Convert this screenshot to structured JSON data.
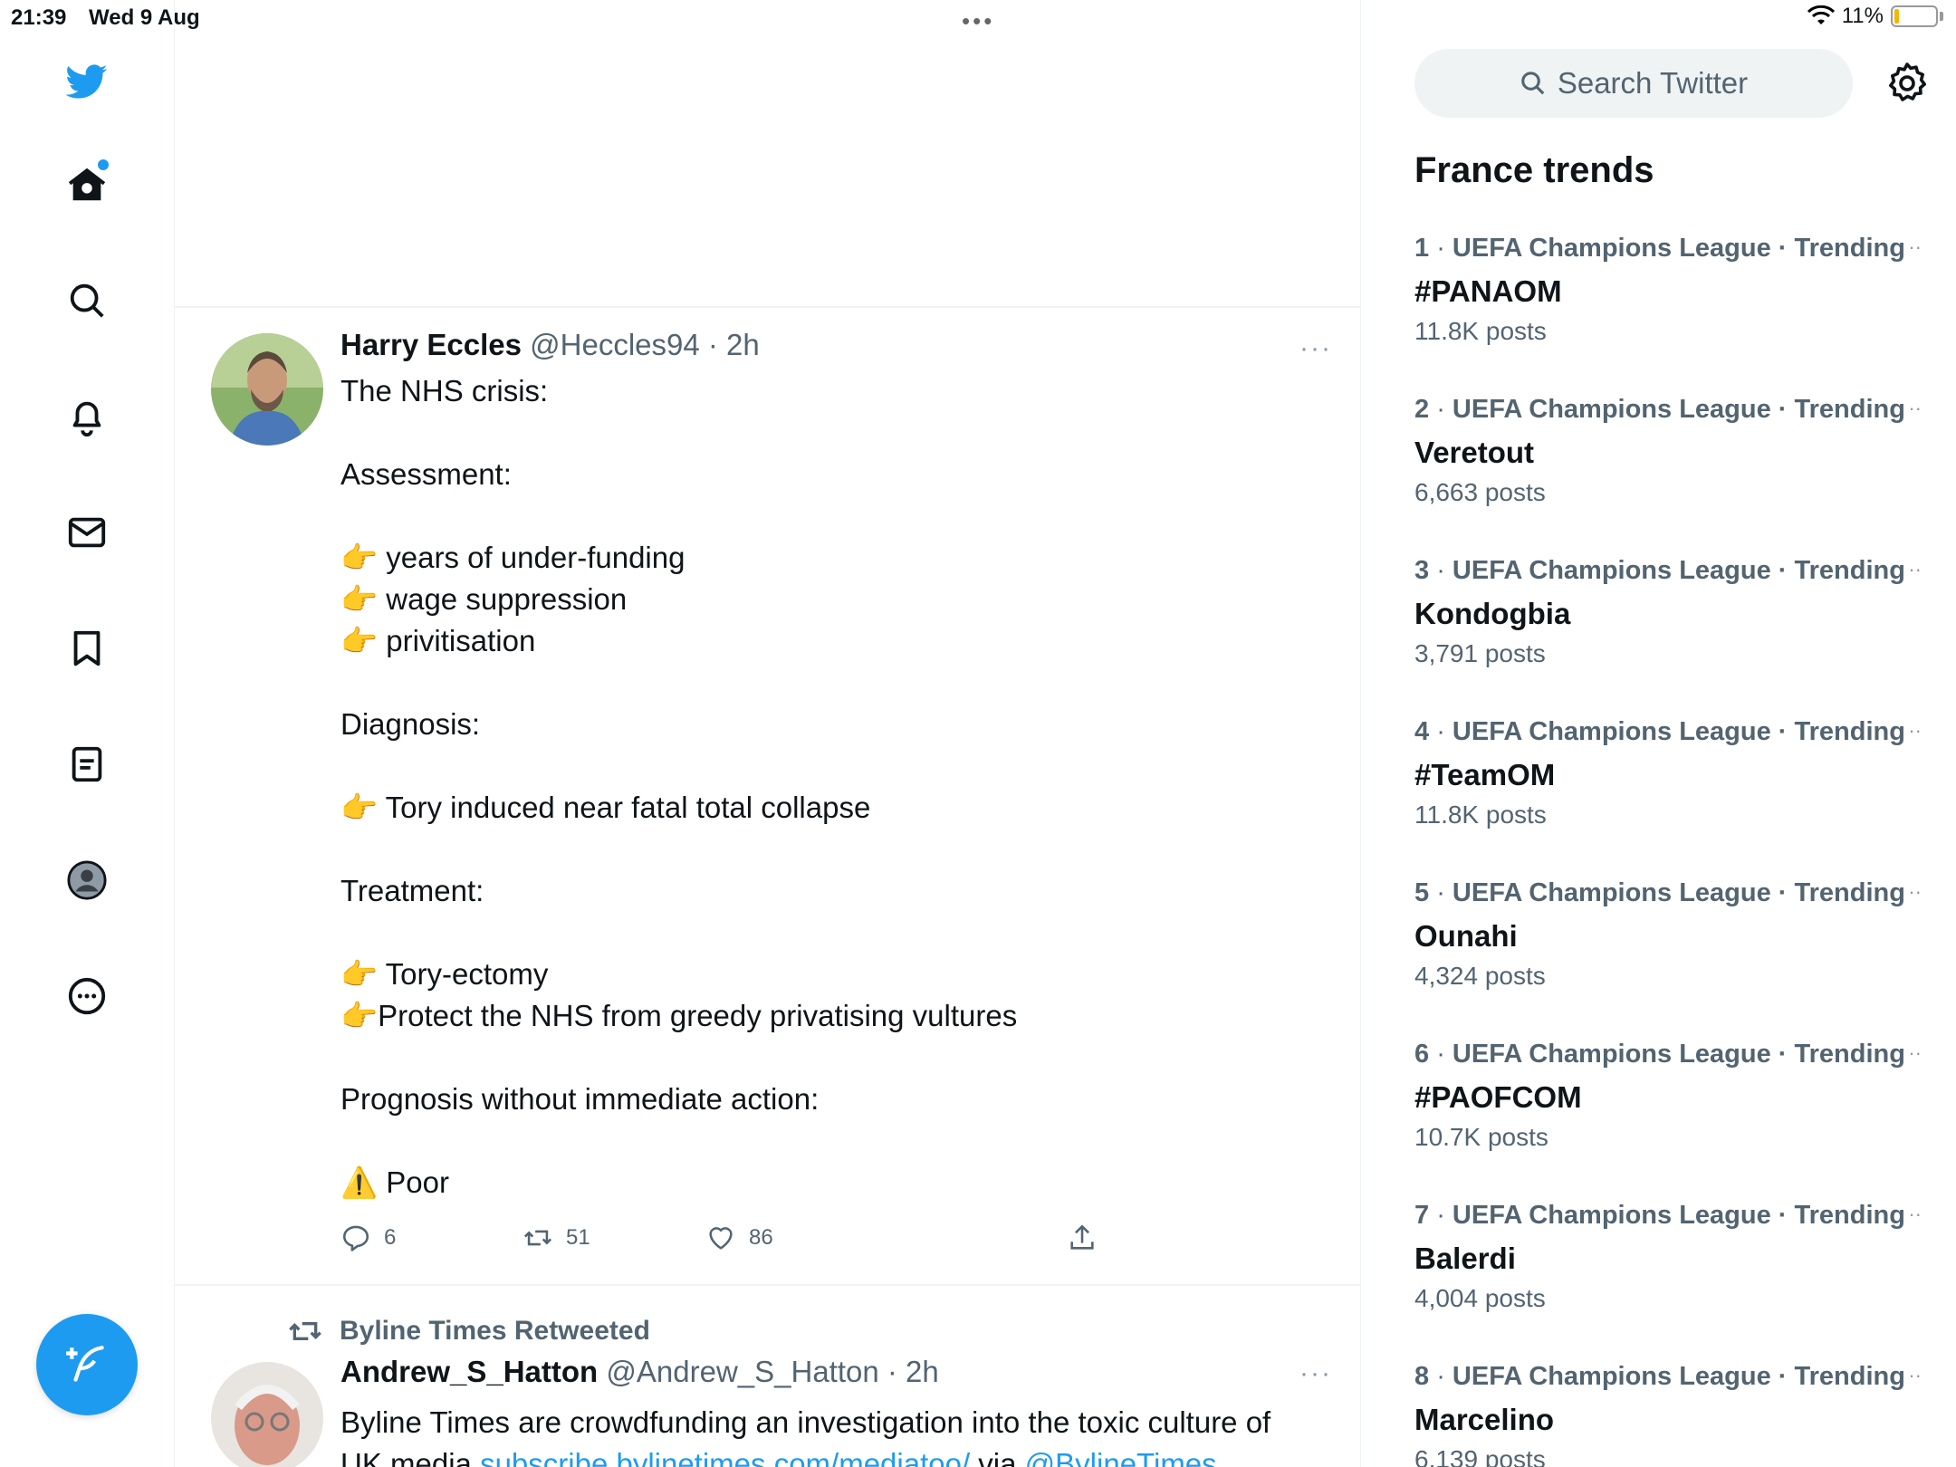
{
  "status_bar": {
    "time": "21:39",
    "date": "Wed 9 Aug",
    "battery": "11%",
    "battery_level": 0.11
  },
  "nav": {
    "icons": [
      "twitter-logo-icon",
      "home-icon",
      "search-icon",
      "bell-icon",
      "mail-icon",
      "bookmark-icon",
      "list-icon",
      "profile-icon",
      "more-icon"
    ],
    "compose_icon": "compose-icon"
  },
  "tweet1": {
    "name": "Harry Eccles",
    "handle": "@Heccles94 · 2h",
    "more": "···",
    "lines": [
      "The NHS crisis:",
      "",
      "Assessment:",
      "",
      "👉 years of under-funding",
      "👉 wage suppression",
      "👉 privitisation",
      "",
      "Diagnosis:",
      "",
      "👉 Tory induced near fatal total collapse",
      "",
      "Treatment:",
      "",
      "👉 Tory-ectomy",
      "👉Protect the NHS from greedy privatising vultures",
      "",
      "Prognosis without immediate action:",
      "",
      "⚠️ Poor"
    ],
    "replies": "6",
    "retweets": "51",
    "likes": "86"
  },
  "tweet2": {
    "retweeted_by": "Byline Times Retweeted",
    "name": "Andrew_S_Hatton",
    "handle": "@Andrew_S_Hatton · 2h",
    "more": "···",
    "text_line1": "Byline Times are crowdfunding an investigation into the toxic culture of",
    "text_line2_prefix": "UK media ",
    "link1": "subscribe.bylinetimes.com/mediatoo/",
    "via": " via ",
    "link2": "@BylineTimes"
  },
  "sidebar": {
    "search_placeholder": "Search Twitter",
    "trends_title": "France trends",
    "trends": [
      {
        "rank": "1",
        "context": "UEFA Champions League · Trending",
        "name": "#PANAOM",
        "count": "11.8K posts"
      },
      {
        "rank": "2",
        "context": "UEFA Champions League · Trending",
        "name": "Veretout",
        "count": "6,663 posts"
      },
      {
        "rank": "3",
        "context": "UEFA Champions League · Trending",
        "name": "Kondogbia",
        "count": "3,791 posts"
      },
      {
        "rank": "4",
        "context": "UEFA Champions League · Trending",
        "name": "#TeamOM",
        "count": "11.8K posts"
      },
      {
        "rank": "5",
        "context": "UEFA Champions League · Trending",
        "name": "Ounahi",
        "count": "4,324 posts"
      },
      {
        "rank": "6",
        "context": "UEFA Champions League · Trending",
        "name": "#PAOFCOM",
        "count": "10.7K posts"
      },
      {
        "rank": "7",
        "context": "UEFA Champions League · Trending",
        "name": "Balerdi",
        "count": "4,004 posts"
      },
      {
        "rank": "8",
        "context": "UEFA Champions League · Trending",
        "name": "Marcelino",
        "count": "6,139 posts"
      }
    ]
  },
  "colors": {
    "accent": "#1d9bf0",
    "text": "#0f1419",
    "muted": "#536471",
    "divider": "#eff3f4"
  }
}
